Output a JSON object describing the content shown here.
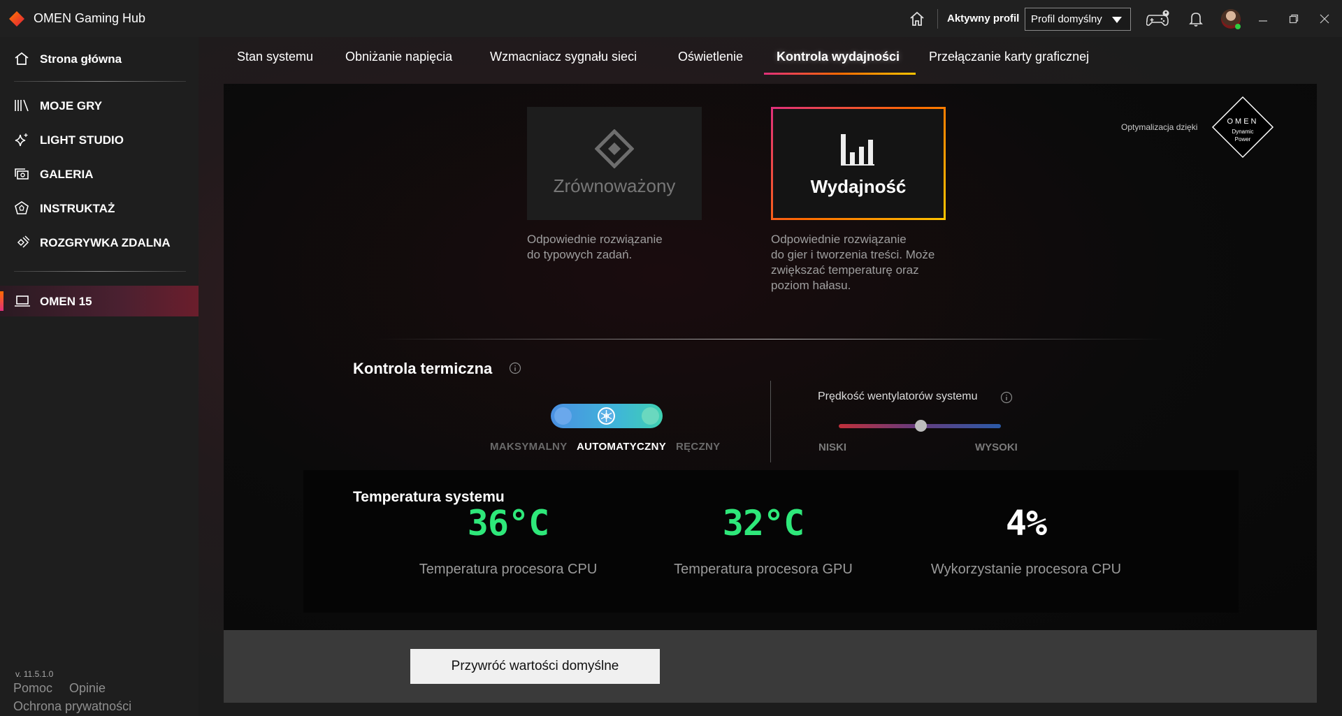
{
  "app": {
    "title": "OMEN Gaming Hub"
  },
  "titlebar": {
    "active_profile_label": "Aktywny profil",
    "profile_value": "Profil domyślny"
  },
  "sidebar": {
    "home": "Strona główna",
    "items": [
      {
        "label": "MOJE GRY",
        "icon": "library-icon"
      },
      {
        "label": "LIGHT STUDIO",
        "icon": "sparkle-icon"
      },
      {
        "label": "GALERIA",
        "icon": "gallery-icon"
      },
      {
        "label": "INSTRUKTAŻ",
        "icon": "coach-icon"
      },
      {
        "label": "ROZGRYWKA ZDALNA",
        "icon": "remote-play-icon"
      }
    ],
    "device": "OMEN 15",
    "version": "v. 11.5.1.0",
    "help": "Pomoc",
    "feedback": "Opinie",
    "privacy": "Ochrona prywatności"
  },
  "tabs": [
    {
      "label": "Stan systemu",
      "active": false
    },
    {
      "label": "Obniżanie napięcia",
      "active": false
    },
    {
      "label": "Wzmacniacz sygnału sieci",
      "active": false
    },
    {
      "label": "Oświetlenie",
      "active": false
    },
    {
      "label": "Kontrola wydajności",
      "active": true
    },
    {
      "label": "Przełączanie karty graficznej",
      "active": false
    }
  ],
  "modes": {
    "balanced": {
      "label": "Zrównoważony",
      "desc1": "Odpowiednie rozwiązanie",
      "desc2": "do typowych zadań."
    },
    "performance": {
      "label": "Wydajność",
      "desc1": "Odpowiednie rozwiązanie",
      "desc2": "do gier i tworzenia treści. Może",
      "desc3": "zwiększać temperaturę oraz",
      "desc4": "poziom hałasu.",
      "selected": true
    }
  },
  "omen_badge": {
    "prefix": "Optymalizacja dzięki",
    "brand": "OMEN",
    "line1": "Dynamic",
    "line2": "Power"
  },
  "thermal": {
    "title": "Kontrola termiczna",
    "mode_max": "MAKSYMALNY",
    "mode_auto": "AUTOMATYCZNY",
    "mode_manual": "RĘCZNY",
    "selected": "AUTOMATYCZNY",
    "fan_title": "Prędkość wentylatorów systemu",
    "fan_low": "NISKI",
    "fan_high": "WYSOKI",
    "fan_level": 0.5
  },
  "temps": {
    "title": "Temperatura systemu",
    "cpu_temp": "36°C",
    "cpu_temp_label": "Temperatura procesora CPU",
    "gpu_temp": "32°C",
    "gpu_temp_label": "Temperatura procesora GPU",
    "cpu_usage": "4%",
    "cpu_usage_label": "Wykorzystanie procesora CPU",
    "accent_color": "#2ee87a"
  },
  "reset_button": "Przywróć wartości domyślne"
}
